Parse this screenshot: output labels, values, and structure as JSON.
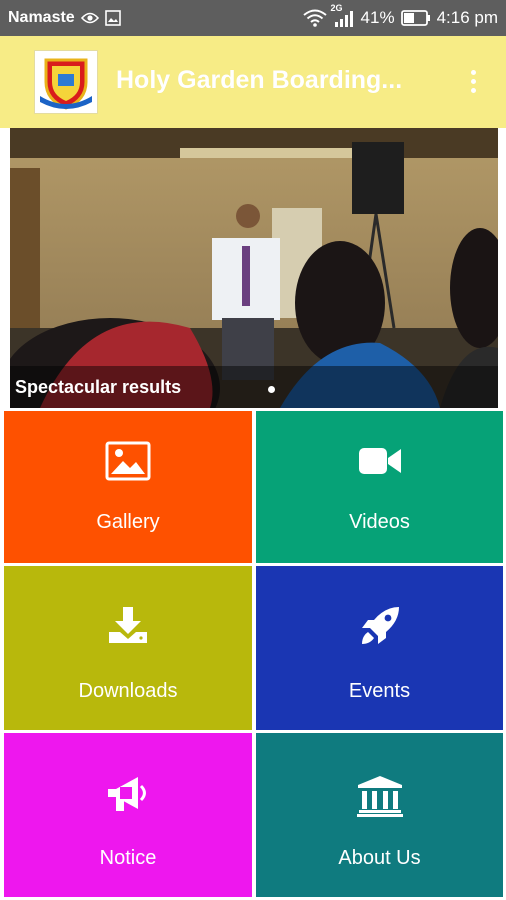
{
  "status_bar": {
    "carrier": "Namaste",
    "network": "2G",
    "battery": "41%",
    "time": "4:16 pm"
  },
  "app_bar": {
    "title": "Holy Garden Boarding...",
    "logo_icon": "school-crest-logo",
    "menu_icon": "overflow-menu-icon"
  },
  "slider": {
    "caption": "Spectacular results",
    "active_slide": 1
  },
  "tiles": [
    {
      "label": "Gallery",
      "icon": "image-icon",
      "color": "#fe5100"
    },
    {
      "label": "Videos",
      "icon": "video-camera-icon",
      "color": "#06a277"
    },
    {
      "label": "Downloads",
      "icon": "download-icon",
      "color": "#b8b80c"
    },
    {
      "label": "Events",
      "icon": "rocket-icon",
      "color": "#1a36b3"
    },
    {
      "label": "Notice",
      "icon": "megaphone-icon",
      "color": "#ee17ee"
    },
    {
      "label": "About Us",
      "icon": "institution-icon",
      "color": "#0f7b7f"
    }
  ]
}
